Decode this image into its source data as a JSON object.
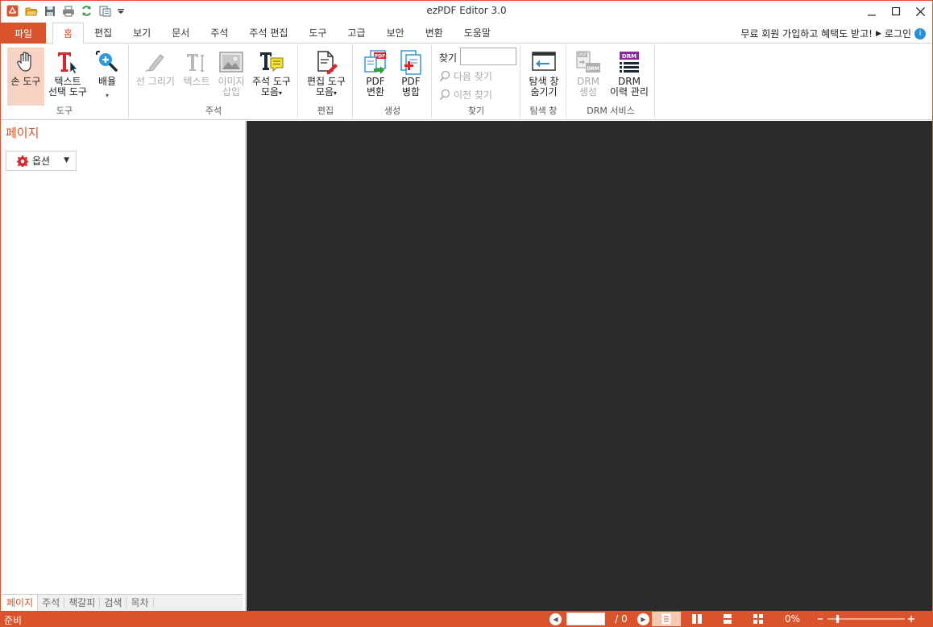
{
  "app": {
    "title": "ezPDF Editor 3.0"
  },
  "quick_access": [
    "app-logo-icon",
    "open-folder-icon",
    "save-icon",
    "print-icon",
    "refresh-icon",
    "page-setup-icon",
    "customize-dropdown-icon"
  ],
  "window_controls": [
    "minimize-icon",
    "maximize-icon",
    "close-icon"
  ],
  "file_tab": "파일",
  "tabs": [
    "홈",
    "편집",
    "보기",
    "문서",
    "주석",
    "주석 편집",
    "도구",
    "고급",
    "보안",
    "변환",
    "도움말"
  ],
  "active_tab": "홈",
  "header_links": {
    "signup": "무료 회원 가입하고 혜택도 받고!",
    "login": "로그인"
  },
  "ribbon": {
    "groups": {
      "tools": "도구",
      "annotation": "주석",
      "edit": "편집",
      "create": "생성",
      "find": "찾기",
      "navpane": "탐색 창",
      "drm": "DRM 서비스"
    },
    "buttons": {
      "hand_tool": {
        "l1": "손 도구",
        "l2": ""
      },
      "text_select": {
        "l1": "텍스트",
        "l2": "선택 도구"
      },
      "zoom": {
        "l1": "배율",
        "l2": ""
      },
      "line_draw": {
        "l1": "선 그리기",
        "l2": ""
      },
      "text": {
        "l1": "텍스트",
        "l2": ""
      },
      "image_insert": {
        "l1": "이미지",
        "l2": "삽입"
      },
      "annot_tools": {
        "l1": "주석 도구",
        "l2": "모음"
      },
      "edit_tools": {
        "l1": "편집 도구",
        "l2": "모음"
      },
      "pdf_convert": {
        "l1": "PDF",
        "l2": "변환"
      },
      "pdf_merge": {
        "l1": "PDF",
        "l2": "병합"
      },
      "hide_pane": {
        "l1": "탐색 창",
        "l2": "숨기기"
      },
      "drm_create": {
        "l1": "DRM",
        "l2": "생성"
      },
      "drm_history": {
        "l1": "DRM",
        "l2": "이력 관리"
      }
    },
    "find": {
      "label": "찾기",
      "value": "",
      "next": "다음 찾기",
      "prev": "이전 찾기"
    }
  },
  "left_panel": {
    "title": "페이지",
    "options_label": "옵션",
    "tabs": [
      "페이지",
      "주석",
      "책갈피",
      "검색",
      "목차"
    ]
  },
  "status": {
    "text": "준비",
    "page_value": "",
    "page_total": "/ 0",
    "zoom": "0%",
    "zoom_level": 0.12
  },
  "colors": {
    "accent": "#d9532c",
    "doc_bg": "#2b2b2b",
    "selected": "#f8d3c3"
  }
}
